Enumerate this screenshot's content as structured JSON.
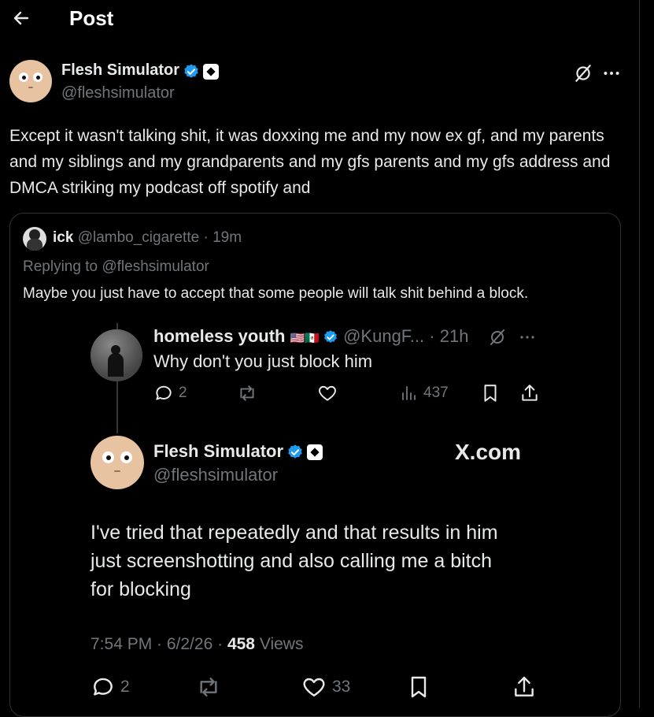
{
  "header": {
    "title": "Post"
  },
  "post": {
    "author_name": "Flesh Simulator",
    "author_handle": "@fleshsimulator",
    "text": "Except it wasn't talking shit, it was doxxing me and my now ex gf, and my parents and my siblings and my grandparents and my gfs parents and my gfs address and DMCA striking my podcast off spotify and"
  },
  "quote": {
    "author_name": "ick",
    "author_handle": "@lambo_cigarette",
    "time": "· 19m",
    "replying_to_prefix": "Replying to",
    "replying_to_handle": "@fleshsimulator",
    "text": "Maybe you just have to accept that some people will talk shit behind a block."
  },
  "screenshot": {
    "parent": {
      "author_name": "homeless youth",
      "flags": "🇺🇸🇲🇽",
      "author_handle": "@KungF...",
      "time": "· 21h",
      "text": "Why don't you just block him",
      "replies": "2",
      "views": "437"
    },
    "reply": {
      "author_name": "Flesh Simulator",
      "author_handle": "@fleshsimulator",
      "watermark": "X.com",
      "text_lines": [
        "I've tried that repeatedly and that results in him",
        "just screenshotting and also calling me a bitch",
        "for blocking"
      ],
      "time": "7:54 PM · 6/2/26 ·",
      "views_count": "458",
      "views_label": "Views",
      "replies": "2",
      "likes": "33"
    }
  },
  "icons": [
    "back-arrow-icon",
    "verified-badge-icon",
    "affiliate-badge-icon",
    "grok-icon",
    "more-icon",
    "reply-icon",
    "repost-icon",
    "like-icon",
    "views-icon",
    "bookmark-icon",
    "share-icon"
  ],
  "colors": {
    "background": "#000000",
    "text": "#e7e9ea",
    "muted": "#71767b",
    "verified": "#1d9bf0",
    "border": "#2f3336"
  }
}
